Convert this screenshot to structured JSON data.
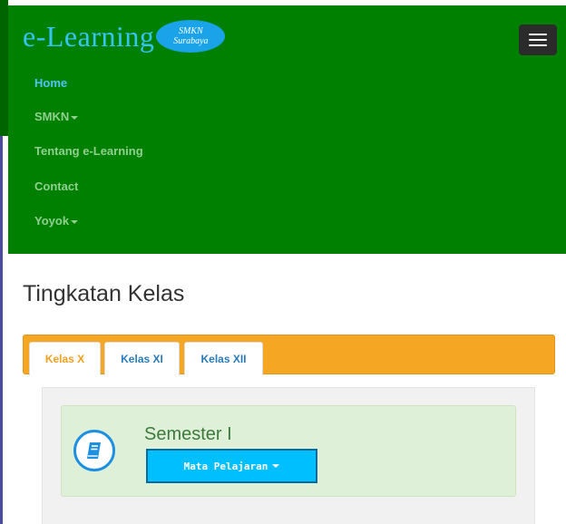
{
  "brand": {
    "title": "e-Learning",
    "badge_line1": "SMKN",
    "badge_line2": "Surabaya"
  },
  "nav": {
    "toggle_icon": "hamburger-menu-icon",
    "items": [
      {
        "label": "Home",
        "active": true
      },
      {
        "label": "SMKN",
        "dropdown": true
      },
      {
        "label": "Tentang e-Learning"
      },
      {
        "label": "Contact"
      },
      {
        "label": "Yoyok",
        "dropdown": true
      }
    ]
  },
  "page": {
    "title": "Tingkatan Kelas"
  },
  "tabs": [
    {
      "label": "Kelas X",
      "active": true
    },
    {
      "label": "Kelas XI"
    },
    {
      "label": "Kelas XII"
    }
  ],
  "card": {
    "icon": "book-icon",
    "title": "Semester I",
    "button_label": "Mata Pelajaran"
  },
  "colors": {
    "navbar": "#008000",
    "brand_text": "#35c4f5",
    "tabs_bar": "#f5a623",
    "card_bg": "#dff0d8",
    "button": "#00bfff"
  }
}
